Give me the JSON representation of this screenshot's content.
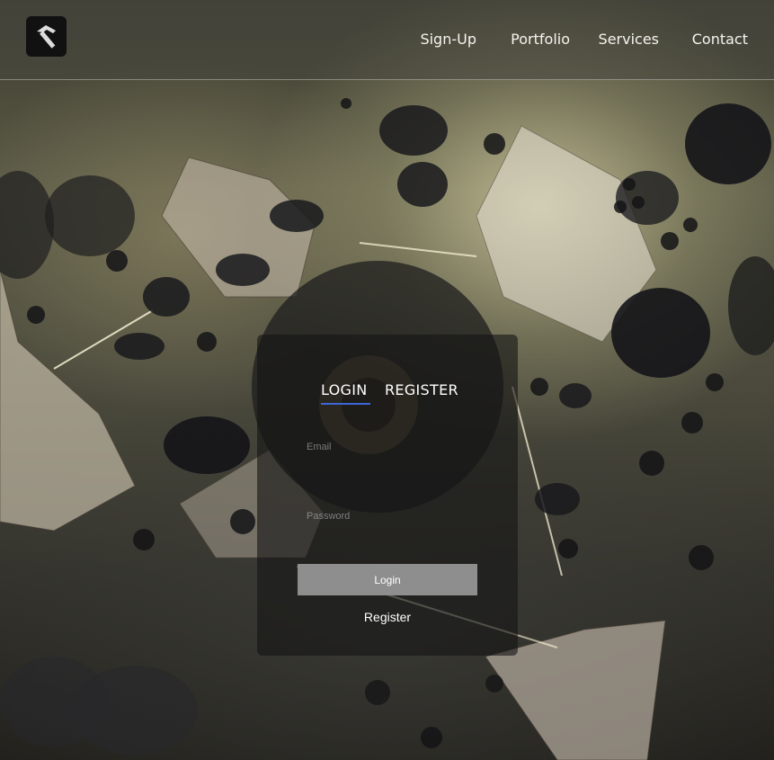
{
  "header": {
    "logo_icon": "hammer-icon",
    "nav": [
      {
        "label": "Sign-Up"
      },
      {
        "label": "Portfolio"
      },
      {
        "label": "Services"
      },
      {
        "label": "Contact"
      }
    ]
  },
  "login_panel": {
    "tabs": [
      {
        "label": "LOGIN",
        "active": true
      },
      {
        "label": "REGISTER",
        "active": false
      }
    ],
    "email_placeholder": "Email",
    "password_placeholder": "Password",
    "login_button": "Login",
    "register_link": "Register"
  },
  "colors": {
    "tab_underline": "#3a66d6",
    "button_bg": "#8e8e8e",
    "panel_bg": "rgba(20,20,20,0.6)"
  }
}
